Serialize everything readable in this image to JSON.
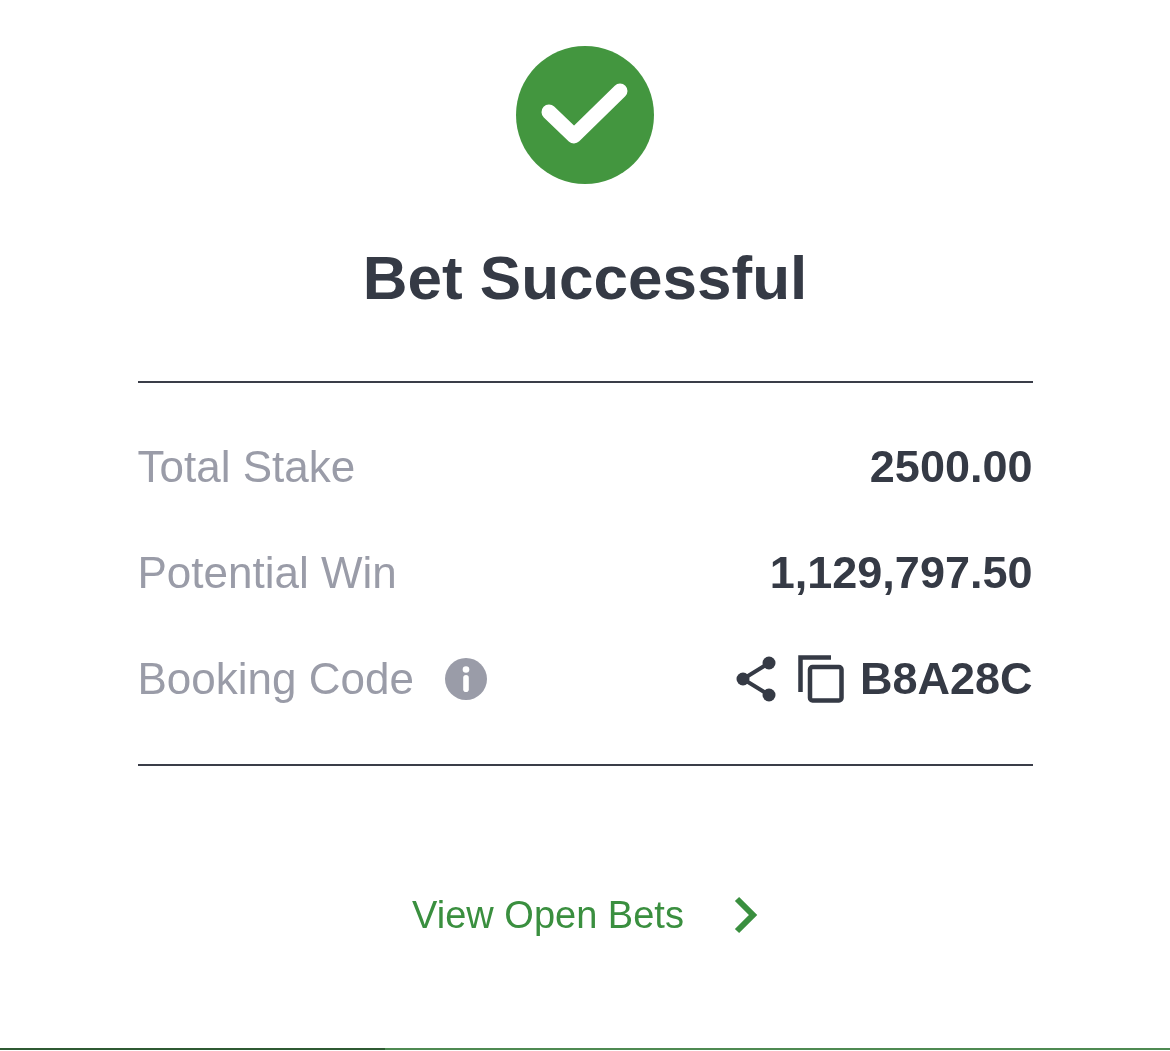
{
  "status": {
    "kind": "success",
    "title": "Bet Successful"
  },
  "summary": [
    {
      "kind": "amount",
      "label": "Total Stake",
      "value": "2500.00"
    },
    {
      "kind": "amount",
      "label": "Potential Win",
      "value": "1,129,797.50"
    },
    {
      "kind": "code",
      "label": "Booking Code",
      "value": "B8A28C"
    }
  ],
  "link": {
    "label": "View Open Bets"
  }
}
